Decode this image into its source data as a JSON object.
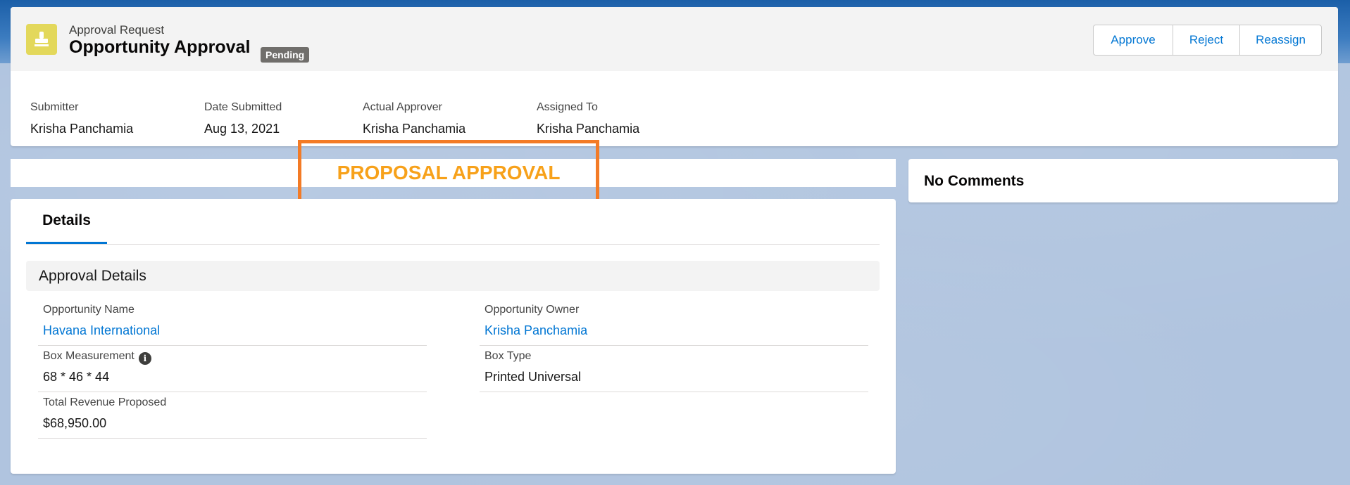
{
  "header": {
    "eyebrow": "Approval Request",
    "title": "Opportunity Approval",
    "status_badge": "Pending",
    "icon": "stamp-icon",
    "actions": {
      "approve": "Approve",
      "reject": "Reject",
      "reassign": "Reassign"
    },
    "fields": [
      {
        "label": "Submitter",
        "value": "Krisha Panchamia"
      },
      {
        "label": "Date Submitted",
        "value": "Aug 13, 2021"
      },
      {
        "label": "Actual Approver",
        "value": "Krisha Panchamia"
      },
      {
        "label": "Assigned To",
        "value": "Krisha Panchamia"
      }
    ]
  },
  "banner": {
    "title": "PROPOSAL APPROVAL"
  },
  "details": {
    "tab_label": "Details",
    "section_title": "Approval Details",
    "fields": {
      "opportunity_name": {
        "label": "Opportunity Name",
        "value": "Havana International"
      },
      "opportunity_owner": {
        "label": "Opportunity Owner",
        "value": "Krisha Panchamia"
      },
      "box_measurement": {
        "label": "Box Measurement",
        "value": "68 * 46 * 44",
        "icon": "info-icon"
      },
      "box_type": {
        "label": "Box Type",
        "value": "Printed Universal"
      },
      "total_revenue": {
        "label": "Total Revenue Proposed",
        "value": "$68,950.00"
      }
    }
  },
  "comments": {
    "title": "No Comments"
  },
  "colors": {
    "brand_blue": "#0176d3",
    "banner_orange": "#f7a11a",
    "callout_border": "#f37b26",
    "icon_yellow": "#e3d85b",
    "page_background": "#b0c4df"
  }
}
